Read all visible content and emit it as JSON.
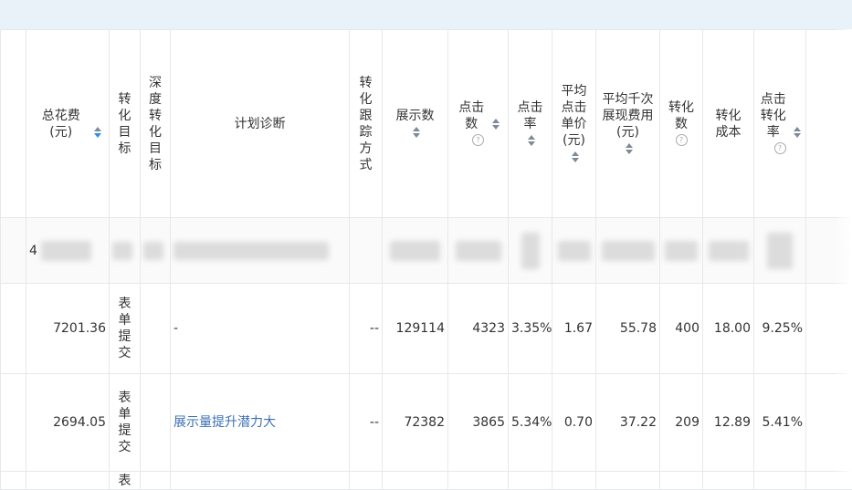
{
  "headers": {
    "total_cost": "总花费(元)",
    "conv_goal": "转化目标",
    "deep_conv_goal": "深度转化目标",
    "plan_diag": "计划诊断",
    "conv_track": "转化跟踪方式",
    "impressions": "展示数",
    "clicks": "点击数",
    "ctr": "点击率",
    "avg_cpc": "平均点击单价(元)",
    "avg_cpm": "平均千次展现费用(元)",
    "conversions": "转化数",
    "conv_cost": "转化成本",
    "cvr": "点击转化率"
  },
  "summary_row": {
    "total_cost_prefix": "4"
  },
  "rows": [
    {
      "total_cost": "7201.36",
      "conv_goal": "表单提交",
      "deep_goal": "",
      "diagnosis": "-",
      "track": "--",
      "impressions": "129114",
      "clicks": "4323",
      "ctr": "3.35%",
      "avg_cpc": "1.67",
      "avg_cpm": "55.78",
      "conversions": "400",
      "conv_cost": "18.00",
      "cvr": "9.25%"
    },
    {
      "total_cost": "2694.05",
      "conv_goal": "表单提交",
      "deep_goal": "",
      "diagnosis": "展示量提升潜力大",
      "track": "--",
      "impressions": "72382",
      "clicks": "3865",
      "ctr": "5.34%",
      "avg_cpc": "0.70",
      "avg_cpm": "37.22",
      "conversions": "209",
      "conv_cost": "12.89",
      "cvr": "5.41%"
    }
  ],
  "partial_row": {
    "conv_goal": "表"
  },
  "help_glyph": "?",
  "colors": {
    "link": "#3a6fb6",
    "sort_active": "#2d8cf0",
    "topbar": "#e9f2f9"
  }
}
